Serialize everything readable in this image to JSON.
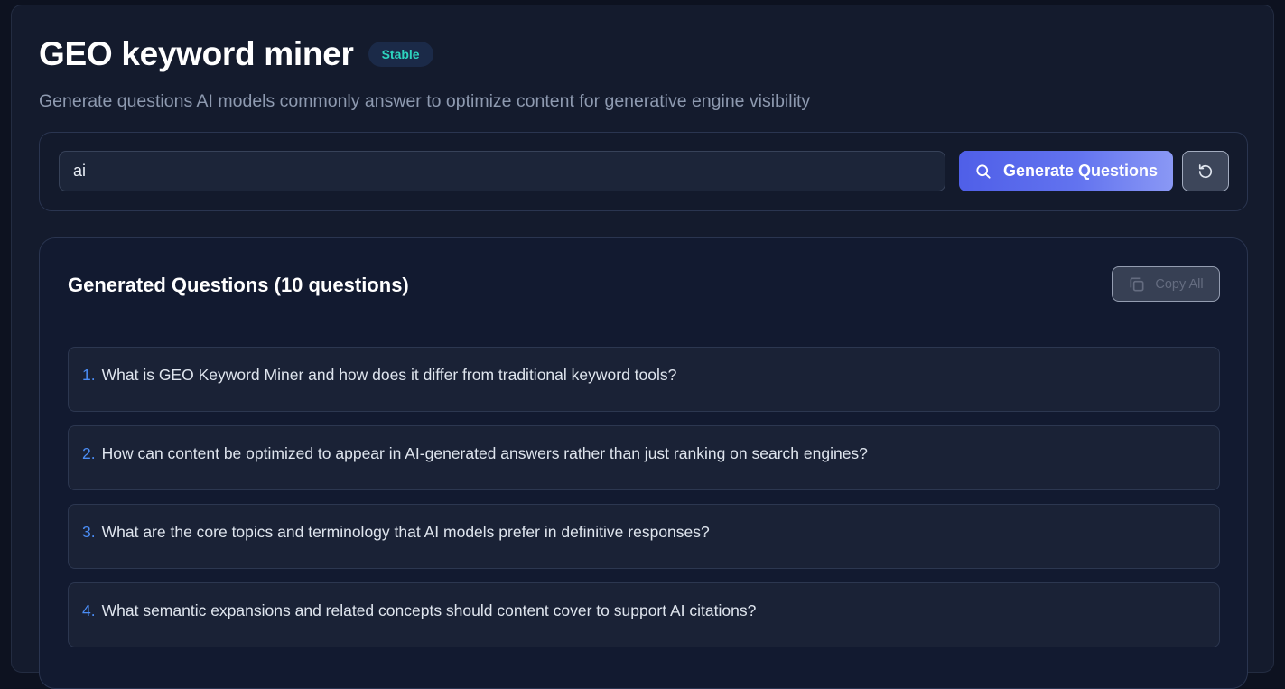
{
  "header": {
    "title": "GEO keyword miner",
    "badge": "Stable",
    "subtitle": "Generate questions AI models commonly answer to optimize content for generative engine visibility"
  },
  "search": {
    "value": "ai",
    "generate_label": "Generate Questions",
    "search_icon": "search-icon",
    "reset_icon": "reset-icon"
  },
  "results": {
    "title": "Generated Questions (10 questions)",
    "copy_label": "Copy All",
    "copy_icon": "copy-icon",
    "questions": [
      {
        "num": "1.",
        "text": "What is GEO Keyword Miner and how does it differ from traditional keyword tools?"
      },
      {
        "num": "2.",
        "text": "How can content be optimized to appear in AI-generated answers rather than just ranking on search engines?"
      },
      {
        "num": "3.",
        "text": "What are the core topics and terminology that AI models prefer in definitive responses?"
      },
      {
        "num": "4.",
        "text": "What semantic expansions and related concepts should content cover to support AI citations?"
      }
    ]
  },
  "colors": {
    "background": "#0d1220",
    "accent": "#5b6bf0",
    "badge_text": "#2dd4bf",
    "number": "#4b8df5"
  }
}
